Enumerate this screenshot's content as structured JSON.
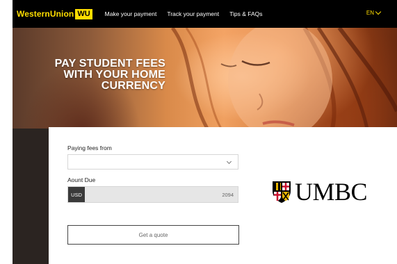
{
  "brand": {
    "name": "WesternUnion",
    "mark": "WU",
    "color": "#ffdd00"
  },
  "nav": {
    "links": [
      "Make your payment",
      "Track your payment",
      "Tips & FAQs"
    ],
    "language": "EN"
  },
  "hero": {
    "line1": "PAY STUDENT FEES",
    "line2": "WITH YOUR HOME",
    "line3": "CURRENCY"
  },
  "form": {
    "paying_from_label": "Paying fees from",
    "paying_from_value": "",
    "amount_label": "Aount Due",
    "currency": "USD",
    "amount_value": "2094",
    "quote_button": "Get a quote"
  },
  "school": {
    "name": "UMBC"
  }
}
